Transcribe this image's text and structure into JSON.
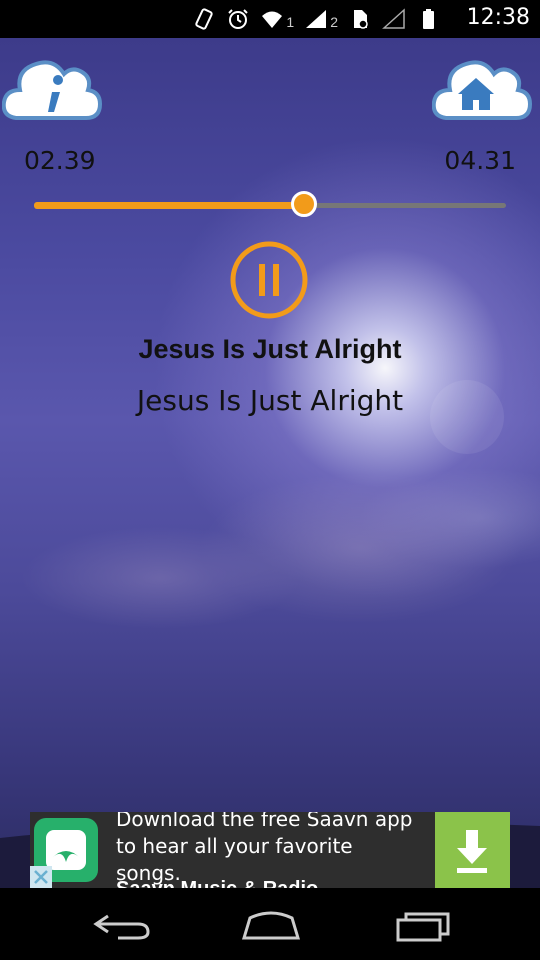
{
  "status_bar": {
    "time": "12:38",
    "sim1": "1",
    "sim2": "2",
    "icons": [
      "vibrate-icon",
      "alarm-icon",
      "wifi-icon",
      "signal-icon",
      "signal-icon",
      "battery-icon"
    ]
  },
  "header": {
    "info_icon": "info-cloud-icon",
    "home_icon": "home-cloud-icon"
  },
  "player": {
    "elapsed": "02.39",
    "total": "04.31",
    "progress_fraction": 0.573,
    "state_icon": "pause-icon",
    "accent_color": "#f29b1a",
    "title": "Jesus Is Just Alright",
    "subtitle": "Jesus Is Just Alright"
  },
  "ad": {
    "text": "Download the free Saavn app to hear all your favorite songs.",
    "title": "Saavn Music & Radio",
    "action_icon": "download-icon",
    "logo_icon": "saavn-logo-icon"
  },
  "nav": {
    "back_icon": "back-icon",
    "home_icon": "home-icon",
    "recents_icon": "recents-icon"
  }
}
